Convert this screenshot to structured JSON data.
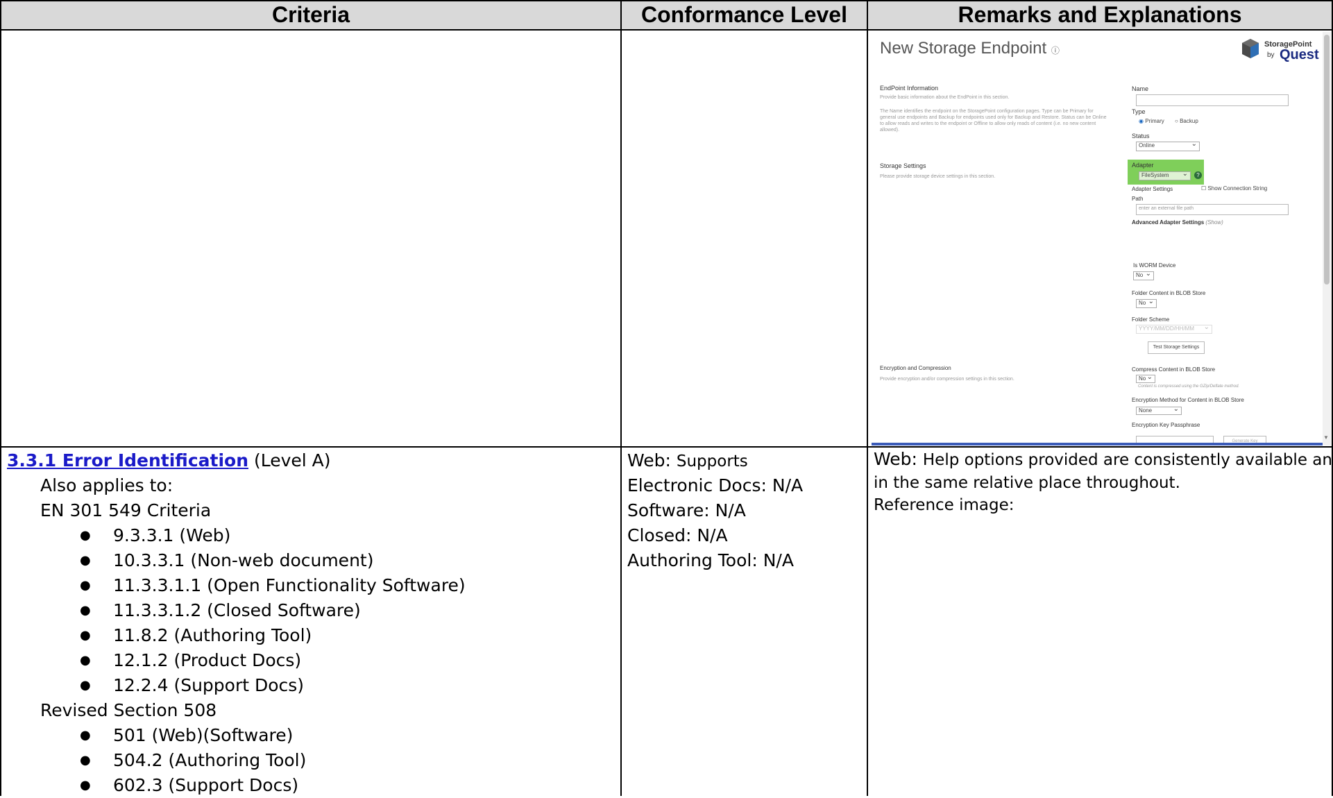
{
  "headers": {
    "criteria": "Criteria",
    "conformance": "Conformance Level",
    "remarks": "Remarks and Explanations"
  },
  "screenshot": {
    "title": "New Storage Endpoint",
    "title_icon": "info-icon",
    "logo": {
      "line1": "StoragePoint",
      "by": "by",
      "brand": "Quest"
    },
    "endpoint_info": {
      "heading": "EndPoint Information",
      "desc1": "Provide basic information about the EndPoint in this section.",
      "desc2": "The Name identifies the endpoint on the StoragePoint configuration pages. Type can be Primary for general use endpoints and Backup for endpoints used only for Backup and Restore. Status can be Online to allow reads and writes to the endpoint or Offline to allow only reads of content (i.e. no new content allowed)."
    },
    "fields": {
      "name_label": "Name",
      "type_label": "Type",
      "type_primary": "Primary",
      "type_backup": "Backup",
      "status_label": "Status",
      "status_value": "Online"
    },
    "storage": {
      "heading": "Storage Settings",
      "desc": "Please provide storage device settings in this section.",
      "adapter_label": "Adapter",
      "adapter_value": "FileSystem",
      "help_icon": "question-circle-icon",
      "adapter_settings_label": "Adapter Settings",
      "show_conn": "Show Connection String",
      "path_label": "Path",
      "path_placeholder": "enter an external file path",
      "advanced_label": "Advanced Adapter Settings",
      "advanced_show": "(Show)",
      "worm_label": "Is WORM Device",
      "worm_value": "No",
      "folder_content_label": "Folder Content in BLOB Store",
      "folder_content_value": "No",
      "folder_scheme_label": "Folder Scheme",
      "folder_scheme_value": "YYYY/MM/DD/HH/MM",
      "test_button": "Test Storage Settings"
    },
    "encryption": {
      "heading": "Encryption and Compression",
      "desc": "Provide encryption and/or compression settings in this section.",
      "compress_label": "Compress Content in BLOB Store",
      "compress_value": "No",
      "compress_note": "Content is compressed using the GZip/Deflate method.",
      "enc_method_label": "Encryption Method for Content in BLOB Store",
      "enc_method_value": "None",
      "passphrase_label": "Encryption Key Passphrase",
      "generate_key": "Generate Key"
    },
    "colors": {
      "adapter_highlight": "#7fcf5a",
      "radio_accent": "#1565c0",
      "scrollbar": "#c2c2c2"
    }
  },
  "row": {
    "criteria": {
      "link": "3.3.1 Error Identification",
      "level": " (Level A)",
      "also": "Also applies to:",
      "en_heading": "EN 301 549 Criteria",
      "en_items": [
        "9.3.3.1 (Web)",
        "10.3.3.1 (Non-web document)",
        "11.3.3.1.1 (Open Functionality Software)",
        "11.3.3.1.2 (Closed Software)",
        "11.8.2 (Authoring Tool)",
        "12.1.2 (Product Docs)",
        "12.2.4 (Support Docs)"
      ],
      "s508_heading": "Revised Section 508",
      "s508_items": [
        "501 (Web)(Software)",
        "504.2 (Authoring Tool)",
        "602.3 (Support Docs)"
      ]
    },
    "conformance": {
      "web_label": "Web: ",
      "web_value": "Supports",
      "docs": "Electronic Docs: N/A",
      "software": "Software: N/A",
      "closed": "Closed: N/A",
      "authoring": "Authoring Tool: N/A"
    },
    "remarks": {
      "web_label": "Web: ",
      "line1": "Help options provided are consistently available and",
      "line2": "in the same relative place throughout.",
      "line3": "Reference image:"
    }
  }
}
